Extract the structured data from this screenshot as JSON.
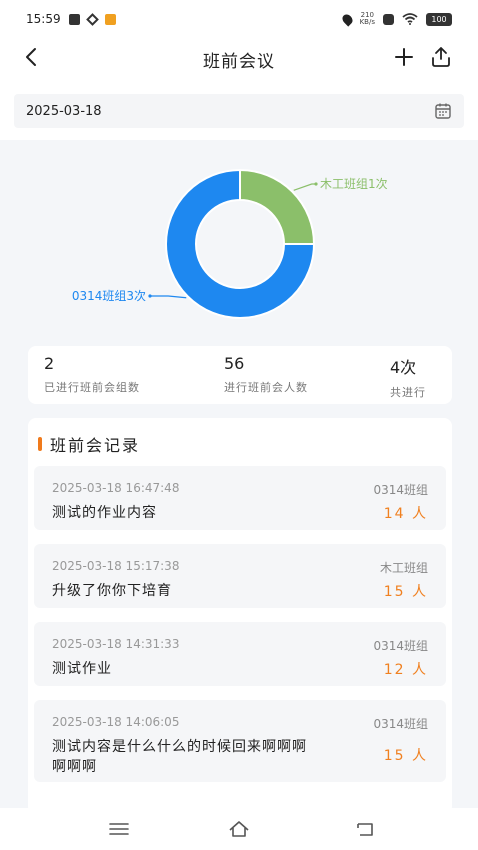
{
  "status_bar": {
    "time": "15:59",
    "net_speed_top": "210",
    "net_speed_bottom": "KB/s",
    "battery": "100"
  },
  "nav": {
    "title": "班前会议",
    "back_icon": "back-arrow-icon",
    "add_icon": "plus-icon",
    "share_icon": "share-icon"
  },
  "date_filter": {
    "value": "2025-03-18",
    "icon": "calendar-icon"
  },
  "chart_data": {
    "type": "pie",
    "categories": [
      "木工班组",
      "0314班组"
    ],
    "values": [
      1,
      3
    ],
    "colors": [
      "#8bbf6a",
      "#1e88f0"
    ],
    "annotations": [
      "木工班组1次",
      "0314班组3次"
    ]
  },
  "stats": [
    {
      "value": "2",
      "label": "已进行班前会组数"
    },
    {
      "value": "56",
      "label": "进行班前会人数"
    },
    {
      "value": "4次",
      "label": "共进行"
    }
  ],
  "records": {
    "title": "班前会记录",
    "items": [
      {
        "time": "2025-03-18 16:47:48",
        "team": "0314班组",
        "content": "测试的作业内容",
        "count": "14 人"
      },
      {
        "time": "2025-03-18 15:17:38",
        "team": "木工班组",
        "content": "升级了你你下培育",
        "count": "15 人"
      },
      {
        "time": "2025-03-18 14:31:33",
        "team": "0314班组",
        "content": "测试作业",
        "count": "12 人"
      },
      {
        "time": "2025-03-18 14:06:05",
        "team": "0314班组",
        "content": "测试内容是什么什么的时候回来啊啊啊啊啊啊",
        "count": "15 人"
      }
    ]
  },
  "bottom_nav": [
    "menu-icon",
    "home-icon",
    "back-icon"
  ]
}
